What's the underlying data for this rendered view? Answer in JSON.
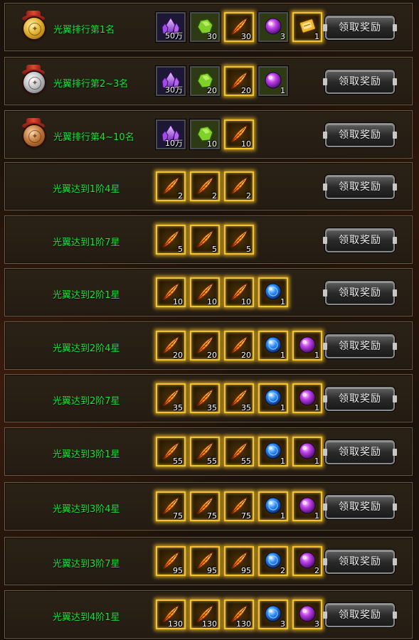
{
  "colors": {
    "label_green": "#19e63a",
    "gold_glow": "#f2c230",
    "row_border": "#6a5a44"
  },
  "icon_names": {
    "crystal": "purple-crystal-icon",
    "jade": "green-stone-icon",
    "feather": "flame-feather-icon",
    "orb_purple": "purple-orb-icon",
    "orb_blue": "blue-orb-icon",
    "scroll": "golden-scroll-icon"
  },
  "rewards": [
    {
      "label": "光翼排行第1名",
      "medal": "gold",
      "button": "领取奖励",
      "items": [
        {
          "icon": "crystal",
          "qty": "50万",
          "frame": "plain"
        },
        {
          "icon": "jade",
          "qty": "30",
          "frame": "plain"
        },
        {
          "icon": "feather",
          "qty": "30",
          "frame": "glow"
        },
        {
          "icon": "orb_purple",
          "qty": "3",
          "frame": "plain"
        },
        {
          "icon": "scroll",
          "qty": "1",
          "frame": "glow"
        }
      ]
    },
    {
      "label": "光翼排行第2~3名",
      "medal": "silver",
      "button": "领取奖励",
      "items": [
        {
          "icon": "crystal",
          "qty": "30万",
          "frame": "plain"
        },
        {
          "icon": "jade",
          "qty": "20",
          "frame": "plain"
        },
        {
          "icon": "feather",
          "qty": "20",
          "frame": "glow"
        },
        {
          "icon": "orb_purple",
          "qty": "1",
          "frame": "plain"
        }
      ]
    },
    {
      "label": "光翼排行第4~10名",
      "medal": "bronze",
      "button": "领取奖励",
      "items": [
        {
          "icon": "crystal",
          "qty": "10万",
          "frame": "plain"
        },
        {
          "icon": "jade",
          "qty": "10",
          "frame": "plain"
        },
        {
          "icon": "feather",
          "qty": "10",
          "frame": "glow"
        }
      ]
    },
    {
      "label": "光翼达到1阶4星",
      "medal": null,
      "button": "领取奖励",
      "items": [
        {
          "icon": "feather",
          "qty": "2",
          "frame": "glow"
        },
        {
          "icon": "feather",
          "qty": "2",
          "frame": "glow"
        },
        {
          "icon": "feather",
          "qty": "2",
          "frame": "glow"
        }
      ]
    },
    {
      "label": "光翼达到1阶7星",
      "medal": null,
      "button": "领取奖励",
      "items": [
        {
          "icon": "feather",
          "qty": "5",
          "frame": "glow"
        },
        {
          "icon": "feather",
          "qty": "5",
          "frame": "glow"
        },
        {
          "icon": "feather",
          "qty": "5",
          "frame": "glow"
        }
      ]
    },
    {
      "label": "光翼达到2阶1星",
      "medal": null,
      "button": "领取奖励",
      "items": [
        {
          "icon": "feather",
          "qty": "10",
          "frame": "glow"
        },
        {
          "icon": "feather",
          "qty": "10",
          "frame": "glow"
        },
        {
          "icon": "feather",
          "qty": "10",
          "frame": "glow"
        },
        {
          "icon": "orb_blue",
          "qty": "1",
          "frame": "glow"
        }
      ]
    },
    {
      "label": "光翼达到2阶4星",
      "medal": null,
      "button": "领取奖励",
      "items": [
        {
          "icon": "feather",
          "qty": "20",
          "frame": "glow"
        },
        {
          "icon": "feather",
          "qty": "20",
          "frame": "glow"
        },
        {
          "icon": "feather",
          "qty": "20",
          "frame": "glow"
        },
        {
          "icon": "orb_blue",
          "qty": "1",
          "frame": "glow"
        },
        {
          "icon": "orb_purple",
          "qty": "1",
          "frame": "glow"
        }
      ]
    },
    {
      "label": "光翼达到2阶7星",
      "medal": null,
      "button": "领取奖励",
      "items": [
        {
          "icon": "feather",
          "qty": "35",
          "frame": "glow"
        },
        {
          "icon": "feather",
          "qty": "35",
          "frame": "glow"
        },
        {
          "icon": "feather",
          "qty": "35",
          "frame": "glow"
        },
        {
          "icon": "orb_blue",
          "qty": "1",
          "frame": "glow"
        },
        {
          "icon": "orb_purple",
          "qty": "1",
          "frame": "glow"
        }
      ]
    },
    {
      "label": "光翼达到3阶1星",
      "medal": null,
      "button": "领取奖励",
      "items": [
        {
          "icon": "feather",
          "qty": "55",
          "frame": "glow"
        },
        {
          "icon": "feather",
          "qty": "55",
          "frame": "glow"
        },
        {
          "icon": "feather",
          "qty": "55",
          "frame": "glow"
        },
        {
          "icon": "orb_blue",
          "qty": "1",
          "frame": "glow"
        },
        {
          "icon": "orb_purple",
          "qty": "1",
          "frame": "glow"
        }
      ]
    },
    {
      "label": "光翼达到3阶4星",
      "medal": null,
      "button": "领取奖励",
      "items": [
        {
          "icon": "feather",
          "qty": "75",
          "frame": "glow"
        },
        {
          "icon": "feather",
          "qty": "75",
          "frame": "glow"
        },
        {
          "icon": "feather",
          "qty": "75",
          "frame": "glow"
        },
        {
          "icon": "orb_blue",
          "qty": "1",
          "frame": "glow"
        },
        {
          "icon": "orb_purple",
          "qty": "1",
          "frame": "glow"
        }
      ]
    },
    {
      "label": "光翼达到3阶7星",
      "medal": null,
      "button": "领取奖励",
      "items": [
        {
          "icon": "feather",
          "qty": "95",
          "frame": "glow"
        },
        {
          "icon": "feather",
          "qty": "95",
          "frame": "glow"
        },
        {
          "icon": "feather",
          "qty": "95",
          "frame": "glow"
        },
        {
          "icon": "orb_blue",
          "qty": "2",
          "frame": "glow"
        },
        {
          "icon": "orb_purple",
          "qty": "2",
          "frame": "glow"
        }
      ]
    },
    {
      "label": "光翼达到4阶1星",
      "medal": null,
      "button": "领取奖励",
      "items": [
        {
          "icon": "feather",
          "qty": "130",
          "frame": "glow"
        },
        {
          "icon": "feather",
          "qty": "130",
          "frame": "glow"
        },
        {
          "icon": "feather",
          "qty": "130",
          "frame": "glow"
        },
        {
          "icon": "orb_blue",
          "qty": "3",
          "frame": "glow"
        },
        {
          "icon": "orb_purple",
          "qty": "3",
          "frame": "glow"
        }
      ]
    }
  ]
}
